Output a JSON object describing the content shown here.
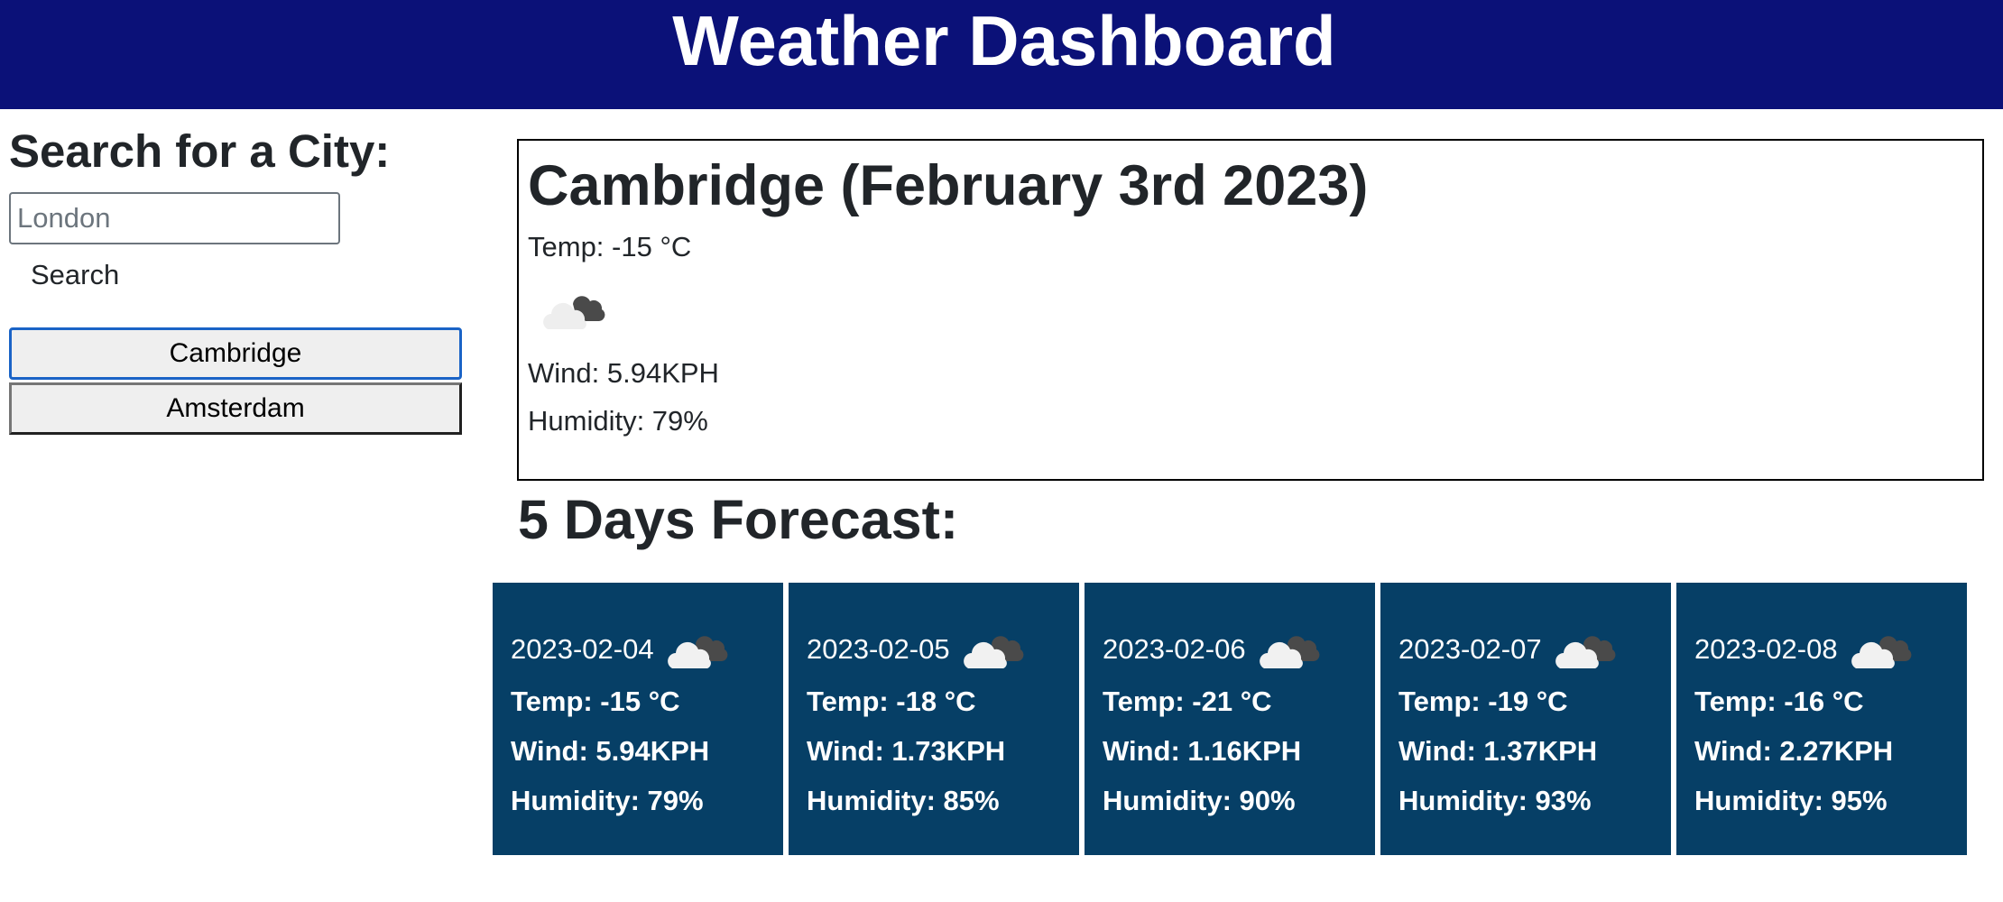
{
  "header": {
    "title": "Weather Dashboard"
  },
  "sidebar": {
    "heading": "Search for a City:",
    "search_placeholder": "London",
    "search_value": "",
    "search_button": "Search",
    "history": [
      {
        "label": "Cambridge",
        "active": true
      },
      {
        "label": "Amsterdam",
        "active": false
      }
    ]
  },
  "current": {
    "title": "Cambridge (February 3rd 2023)",
    "temp": "Temp: -15 °C",
    "icon": "cloudy-icon",
    "wind": "Wind: 5.94KPH",
    "humidity": "Humidity: 79%"
  },
  "forecast": {
    "title": "5 Days Forecast:",
    "days": [
      {
        "date": "2023-02-04",
        "icon": "cloudy-icon",
        "temp": "Temp: -15 °C",
        "wind": "Wind: 5.94KPH",
        "humidity": "Humidity: 79%"
      },
      {
        "date": "2023-02-05",
        "icon": "cloudy-icon",
        "temp": "Temp: -18 °C",
        "wind": "Wind: 1.73KPH",
        "humidity": "Humidity: 85%"
      },
      {
        "date": "2023-02-06",
        "icon": "cloudy-icon",
        "temp": "Temp: -21 °C",
        "wind": "Wind: 1.16KPH",
        "humidity": "Humidity: 90%"
      },
      {
        "date": "2023-02-07",
        "icon": "cloudy-icon",
        "temp": "Temp: -19 °C",
        "wind": "Wind: 1.37KPH",
        "humidity": "Humidity: 93%"
      },
      {
        "date": "2023-02-08",
        "icon": "cloudy-icon",
        "temp": "Temp: -16 °C",
        "wind": "Wind: 2.27KPH",
        "humidity": "Humidity: 95%"
      }
    ]
  },
  "colors": {
    "header_bg": "#0b1178",
    "card_bg": "#063f66",
    "active_border": "#1a63c6"
  }
}
